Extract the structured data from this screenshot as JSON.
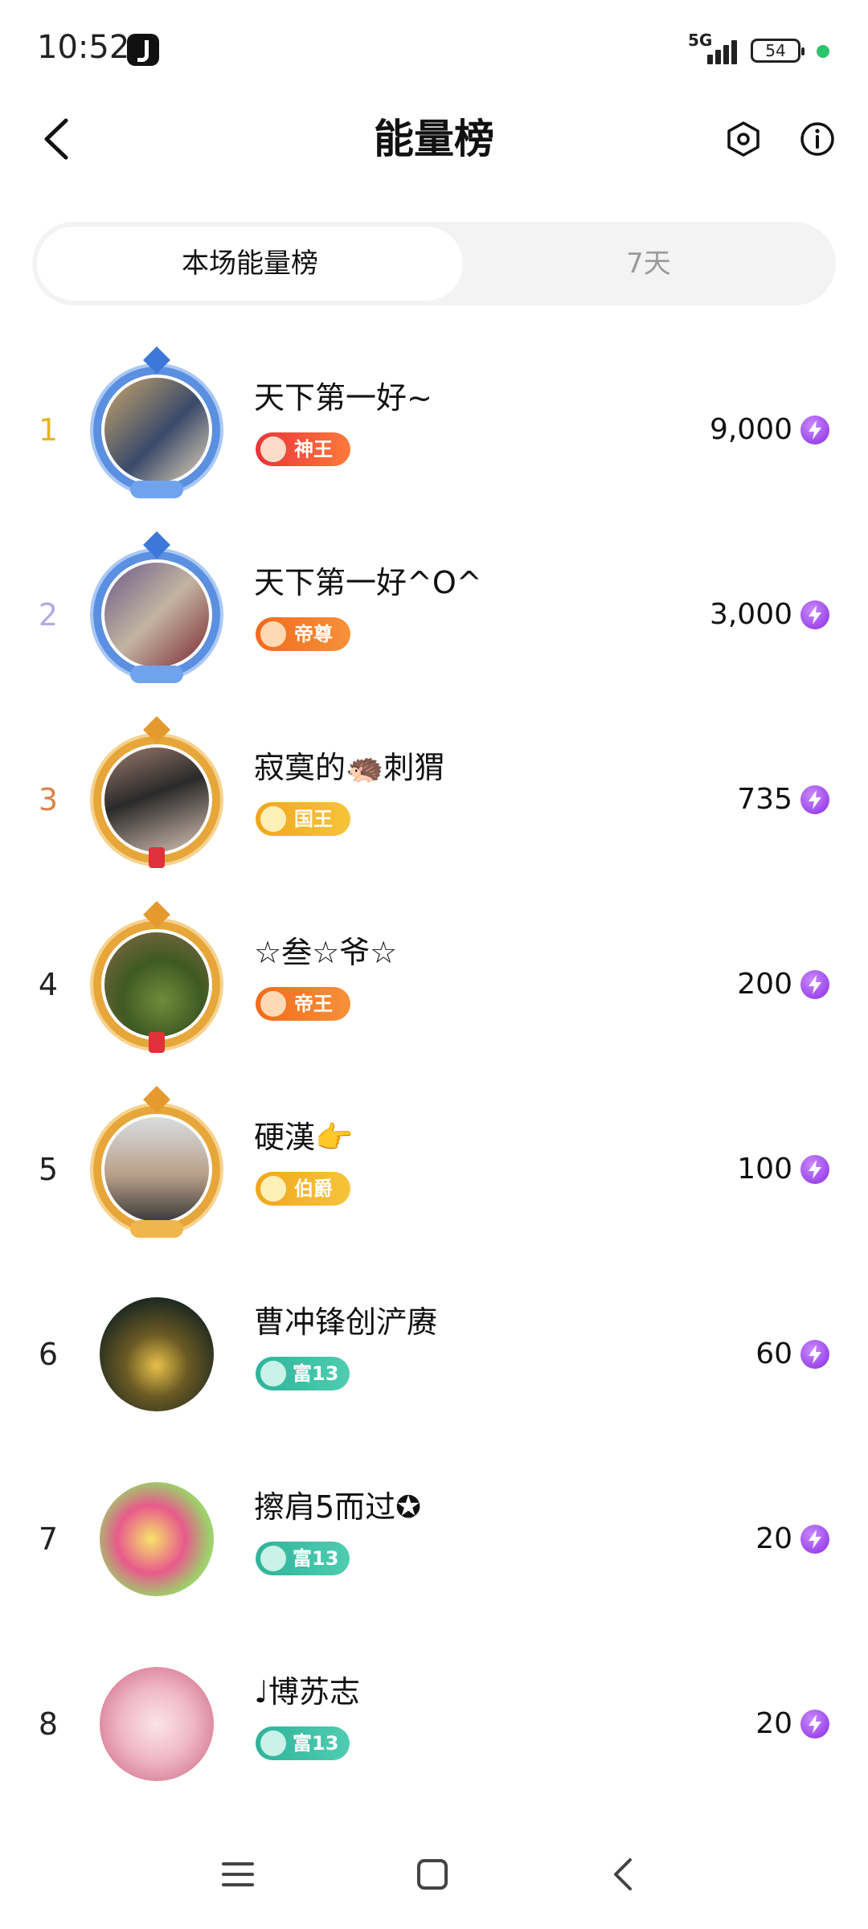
{
  "status_bar": {
    "time": "10:52",
    "network": "5G",
    "battery": "54"
  },
  "header": {
    "title": "能量榜",
    "icons": [
      "back-icon",
      "hexagon-settings-icon",
      "info-icon"
    ]
  },
  "tabs": [
    {
      "label": "本场能量榜",
      "active": true
    },
    {
      "label": "7天",
      "active": false
    }
  ],
  "colors": {
    "rank1": "#e6b422",
    "rank2": "#b3a9e6",
    "rank3": "#d9844a",
    "energy": "#8a2be2",
    "badge_teal": "#2fb39a"
  },
  "list": [
    {
      "rank": "1",
      "name": "天下第一好~",
      "badge": "神王",
      "score": "9,000"
    },
    {
      "rank": "2",
      "name": "天下第一好^O^",
      "badge": "帝尊",
      "score": "3,000"
    },
    {
      "rank": "3",
      "name": "寂寞的🦔刺猬",
      "badge": "国王",
      "score": "735"
    },
    {
      "rank": "4",
      "name": "☆叁☆爷☆",
      "badge": "帝王",
      "score": "200"
    },
    {
      "rank": "5",
      "name": "硬漢👉",
      "badge": "伯爵",
      "score": "100"
    },
    {
      "rank": "6",
      "name": "曹冲锋创浐赓",
      "badge": "富13",
      "score": "60"
    },
    {
      "rank": "7",
      "name": "擦肩5而过✪",
      "badge": "富13",
      "score": "20"
    },
    {
      "rank": "8",
      "name": "♩博苏志",
      "badge": "富13",
      "score": "20"
    }
  ],
  "nav": [
    "menu-icon",
    "home-icon",
    "back-icon"
  ]
}
